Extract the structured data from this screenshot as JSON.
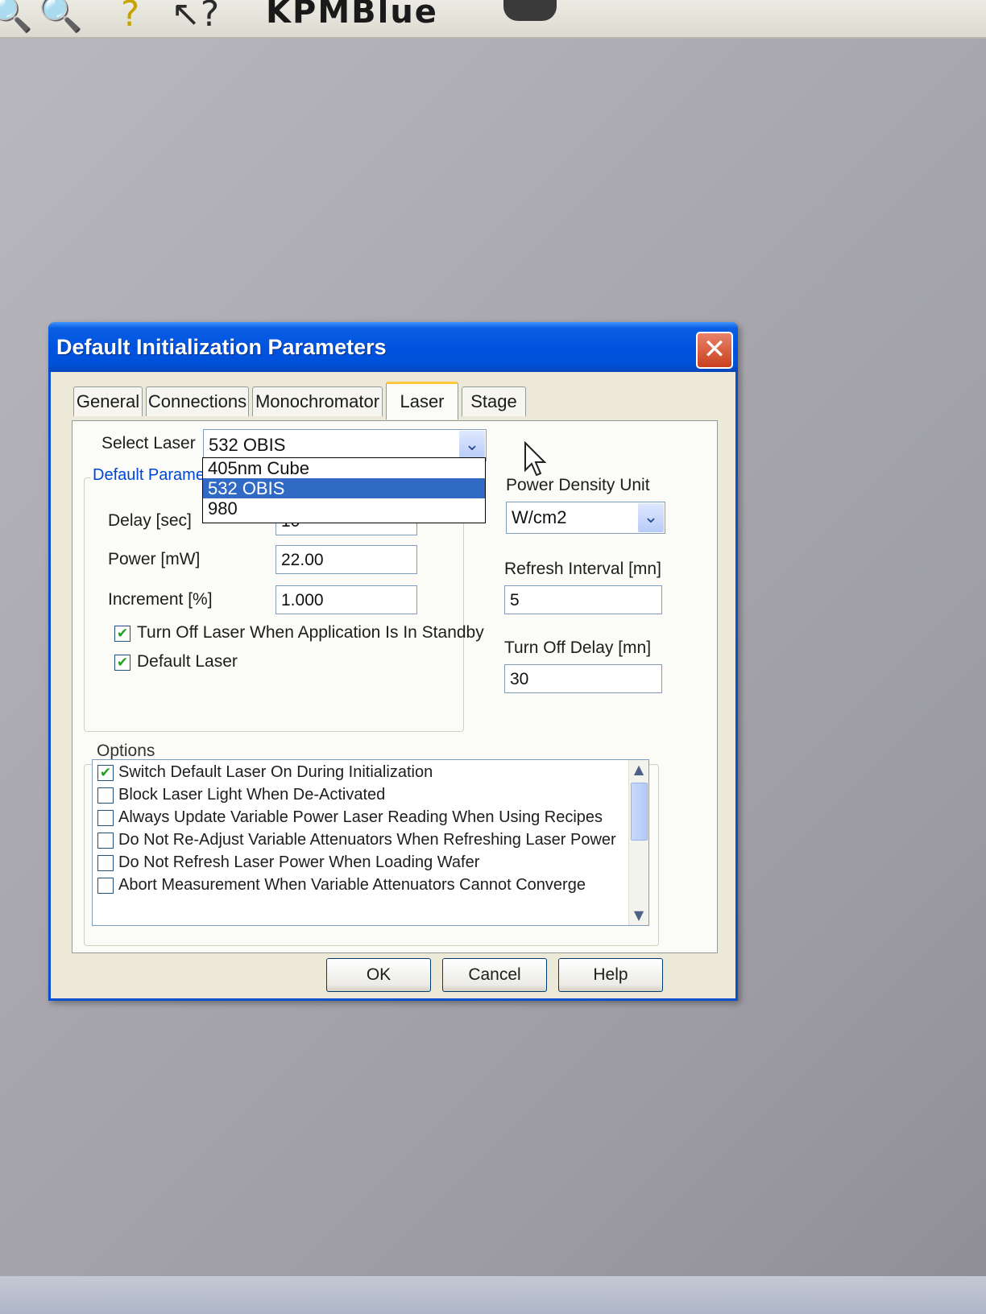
{
  "toolbar": {
    "icon_zoom_a": "🔍",
    "icon_zoom_b": "🔍",
    "icon_help": "?",
    "icon_whats_this": "↖?",
    "app_name_fragment": "KPMBlue"
  },
  "dialog": {
    "title": "Default Initialization Parameters",
    "close_glyph": "✕",
    "tabs": [
      {
        "label": "General"
      },
      {
        "label": "Connections"
      },
      {
        "label": "Monochromator"
      },
      {
        "label": "Laser"
      },
      {
        "label": "Stage"
      }
    ],
    "active_tab": "Laser",
    "select_laser": {
      "label": "Select Laser",
      "value": "532 OBIS",
      "options": [
        "405nm Cube",
        "532 OBIS",
        "980"
      ],
      "selected_option": "532 OBIS"
    },
    "default_params": {
      "group_title": "Default Parame",
      "delay_label": "Delay [sec]",
      "delay_value": "10",
      "power_label": "Power [mW]",
      "power_value": "22.00",
      "increment_label": "Increment [%]",
      "increment_value": "1.000",
      "turn_off_standby_label": "Turn Off Laser When Application Is In Standby",
      "turn_off_standby_checked": true,
      "default_laser_label": "Default Laser",
      "default_laser_checked": true
    },
    "right_panel": {
      "power_density_unit_label": "Power Density Unit",
      "power_density_unit_value": "W/cm2",
      "refresh_interval_label": "Refresh Interval [mn]",
      "refresh_interval_value": "5",
      "turn_off_delay_label": "Turn Off Delay [mn]",
      "turn_off_delay_value": "30"
    },
    "options": {
      "title": "Options",
      "items": [
        {
          "label": "Switch Default Laser On During Initialization",
          "checked": true
        },
        {
          "label": "Block Laser Light When De-Activated",
          "checked": false
        },
        {
          "label": "Always Update Variable Power Laser Reading When Using Recipes",
          "checked": false
        },
        {
          "label": "Do Not Re-Adjust Variable Attenuators When Refreshing Laser Power",
          "checked": false
        },
        {
          "label": "Do Not Refresh Laser Power When Loading Wafer",
          "checked": false
        },
        {
          "label": "Abort Measurement When Variable Attenuators Cannot Converge",
          "checked": false
        }
      ]
    },
    "buttons": {
      "ok": "OK",
      "cancel": "Cancel",
      "help": "Help"
    }
  },
  "colors": {
    "title_bar": "#0053e0",
    "selection": "#316ac5",
    "group_title": "#0046d5",
    "dialog_face": "#ece9d8"
  }
}
